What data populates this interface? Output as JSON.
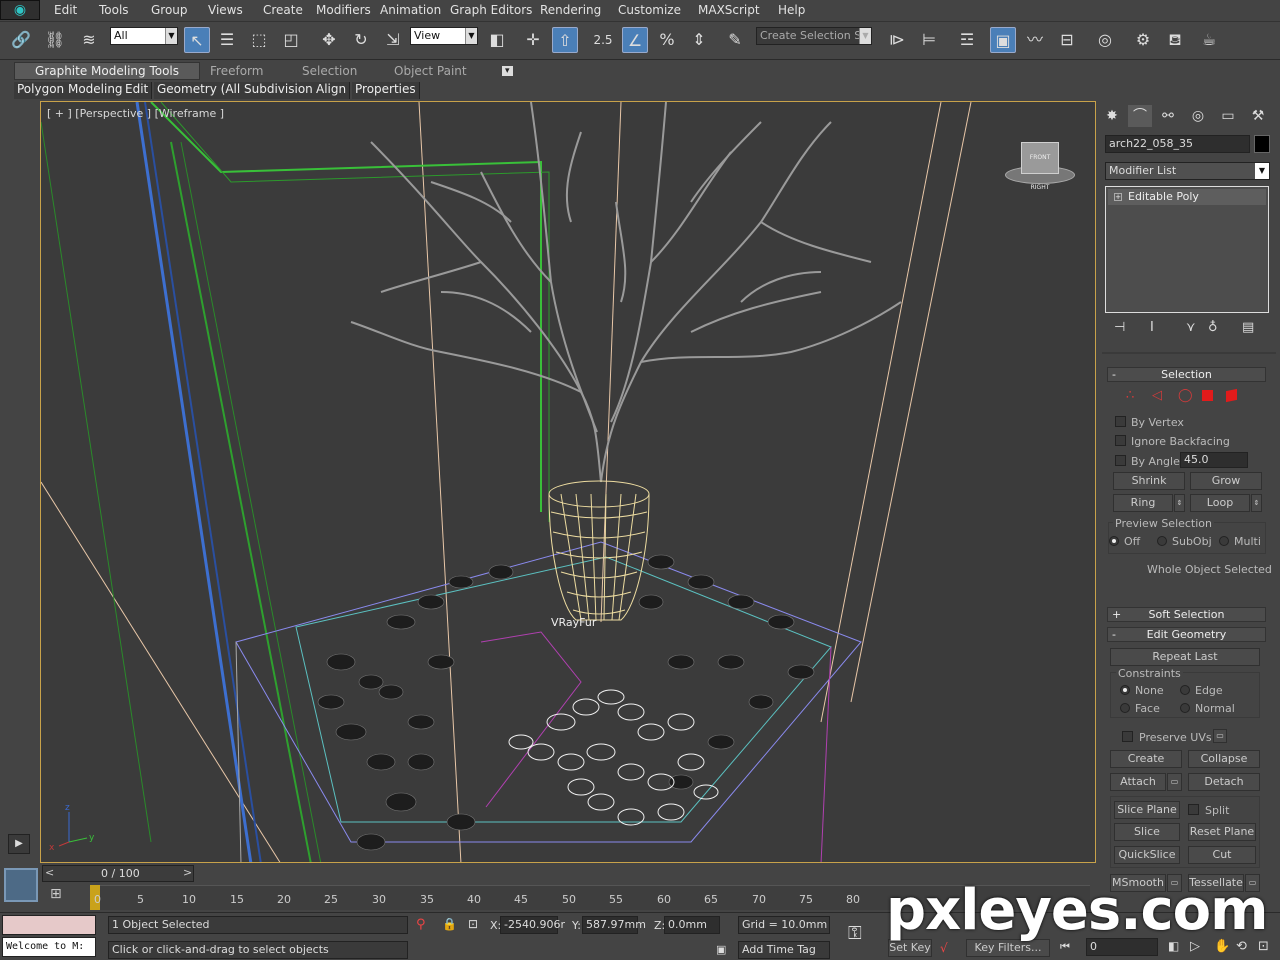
{
  "menu": [
    "Edit",
    "Tools",
    "Group",
    "Views",
    "Create",
    "Modifiers",
    "Animation",
    "Graph Editors",
    "Rendering",
    "Customize",
    "MAXScript",
    "Help"
  ],
  "toolbar": {
    "filter_value": "All",
    "refcoord_value": "View",
    "snap_value": "2.5",
    "named_selection_placeholder": "Create Selection Se"
  },
  "ribbon": {
    "tabs": [
      "Graphite Modeling Tools",
      "Freeform",
      "Selection",
      "Object Paint"
    ],
    "subtabs": [
      "Polygon Modeling",
      "Edit",
      "Geometry (All)",
      "Subdivision",
      "Align",
      "Properties"
    ]
  },
  "viewport": {
    "label": "[ + ] [Perspective ] [Wireframe ]",
    "object_label": "VRayFur",
    "border_color": "#c8a24a",
    "cube_labels": [
      "FRONT",
      "RIGHT"
    ]
  },
  "command_panel": {
    "object_name": "arch22_058_35",
    "modifier_list": "Modifier List",
    "stack_item": "Editable Poly",
    "selection": {
      "title": "Selection",
      "by_vertex": "By Vertex",
      "ignore_backfacing": "Ignore Backfacing",
      "by_angle": "By Angle:",
      "angle_value": "45.0",
      "shrink": "Shrink",
      "grow": "Grow",
      "ring": "Ring",
      "loop": "Loop",
      "preview_title": "Preview Selection",
      "preview_off": "Off",
      "preview_subobj": "SubObj",
      "preview_multi": "Multi",
      "status": "Whole Object Selected"
    },
    "soft_selection": "Soft Selection",
    "edit_geometry": {
      "title": "Edit Geometry",
      "repeat_last": "Repeat Last",
      "constraints": "Constraints",
      "none": "None",
      "edge": "Edge",
      "face": "Face",
      "normal": "Normal",
      "preserve_uvs": "Preserve UVs",
      "create": "Create",
      "collapse": "Collapse",
      "attach": "Attach",
      "detach": "Detach",
      "slice_plane": "Slice Plane",
      "split": "Split",
      "slice": "Slice",
      "reset_plane": "Reset Plane",
      "quickslice": "QuickSlice",
      "cut": "Cut",
      "msmooth": "MSmooth",
      "tessellate": "Tessellate"
    }
  },
  "timeline": {
    "frame_display": "0 / 100",
    "ticks": [
      "0",
      "5",
      "10",
      "15",
      "20",
      "25",
      "30",
      "35",
      "40",
      "45",
      "50",
      "55",
      "60",
      "65",
      "70",
      "75",
      "80"
    ]
  },
  "status": {
    "maxscript": "Welcome to M:",
    "selected": "1 Object Selected",
    "prompt": "Click or click-and-drag to select objects",
    "x_label": "X:",
    "x_value": "-2540.906r",
    "y_label": "Y:",
    "y_value": "587.97mm",
    "z_label": "Z:",
    "z_value": "0.0mm",
    "grid": "Grid = 10.0mm",
    "add_time_tag": "Add Time Tag",
    "set_key": "Set Key",
    "key_filters": "Key Filters...",
    "frame_value": "0"
  },
  "watermark": "pxleyes.com"
}
